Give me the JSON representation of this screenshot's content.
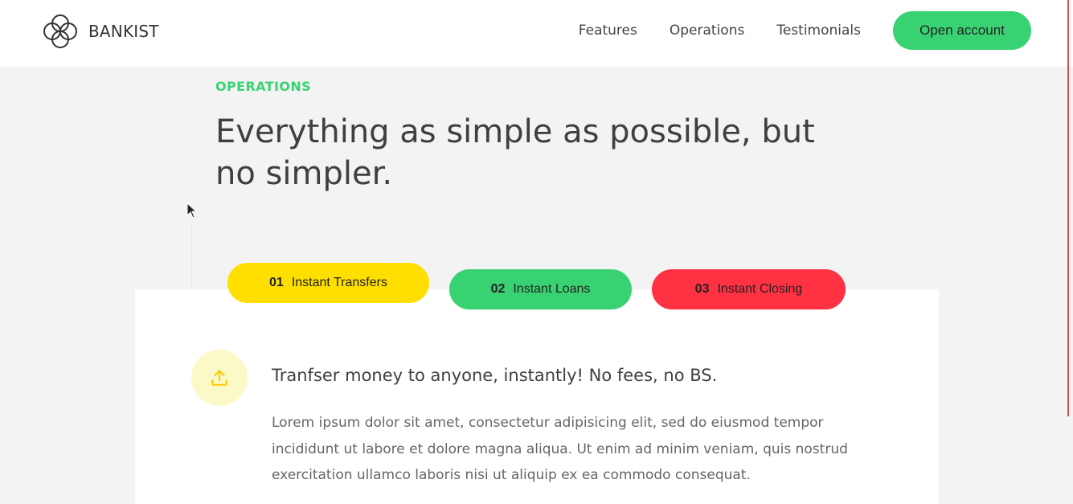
{
  "header": {
    "logo_text": "BANKIST",
    "nav": [
      {
        "label": "Features"
      },
      {
        "label": "Operations"
      },
      {
        "label": "Testimonials"
      }
    ],
    "cta_label": "Open account"
  },
  "section": {
    "label": "OPERATIONS",
    "title": "Everything as simple as possible, but no simpler."
  },
  "tabs": [
    {
      "number": "01",
      "label": "Instant Transfers",
      "color": "#ffdf00",
      "active": true
    },
    {
      "number": "02",
      "label": "Instant Loans",
      "color": "#39d273",
      "active": false
    },
    {
      "number": "03",
      "label": "Instant Closing",
      "color": "#ff3243",
      "active": false
    }
  ],
  "content": {
    "icon": "upload-icon",
    "heading": "Tranfser money to anyone, instantly! No fees, no BS.",
    "body": "Lorem ipsum dolor sit amet, consectetur adipisicing elit, sed do eiusmod tempor incididunt ut labore et dolore magna aliqua. Ut enim ad minim veniam, quis nostrud exercitation ullamco laboris nisi ut aliquip ex ea commodo consequat."
  },
  "colors": {
    "accent_green": "#39d273",
    "accent_yellow": "#ffdf00",
    "accent_red": "#ff3243",
    "background": "#f3f3f3"
  }
}
